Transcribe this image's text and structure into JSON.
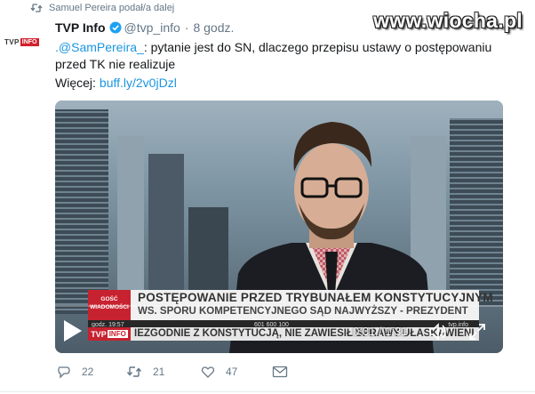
{
  "retweet_context": {
    "text": "Samuel Pereira podał/a dalej",
    "icon": "retweet-icon"
  },
  "watermark": "www.wiocha.pl",
  "author": {
    "avatar_label": "TVP",
    "avatar_badge": "INFO",
    "name": "TVP Info",
    "verified_icon": "verified-icon",
    "handle": "@tvp_info",
    "separator": "·",
    "time": "8 godz."
  },
  "tweet": {
    "mention": ".@SamPereira_",
    "text": ": pytanie jest do SN, dlaczego przepisu ustawy o postępowaniu przed TK nie realizuje",
    "more_label": "Więcej:",
    "link": "buff.ly/2v0jDzl"
  },
  "video": {
    "lower_third": {
      "badge_line1": "GOŚĆ",
      "badge_line2": "WIADOMOŚCI",
      "title": "POSTĘPOWANIE PRZED TRYBUNAŁEM KONSTYTUCYJNYM",
      "subtitle": "WS. SPORU KOMPETENCYJNEGO SĄD NAJWYŻSZY - PREZYDENT",
      "strip_time": "godz. 19:57",
      "strip_phone": "601 600 100",
      "strip_url": "tvp.info"
    },
    "ticker": {
      "logo_left": "TVP",
      "logo_right": "INFO",
      "text": "IEZGODNIE Z KONSTYTUCJĄ, NIE ZAWIESIŁ SPRAWY UŁASKAWIENI"
    },
    "timecode": "0:01 / 1:31",
    "play_icon": "play-icon",
    "volume_icon": "volume-icon",
    "fullscreen_icon": "fullscreen-icon"
  },
  "actions": {
    "reply_count": "22",
    "retweet_count": "21",
    "like_count": "47",
    "message_icon": "direct-message-icon"
  },
  "colors": {
    "link": "#1b95e0",
    "muted": "#657786",
    "brand_red": "#c7222f"
  }
}
